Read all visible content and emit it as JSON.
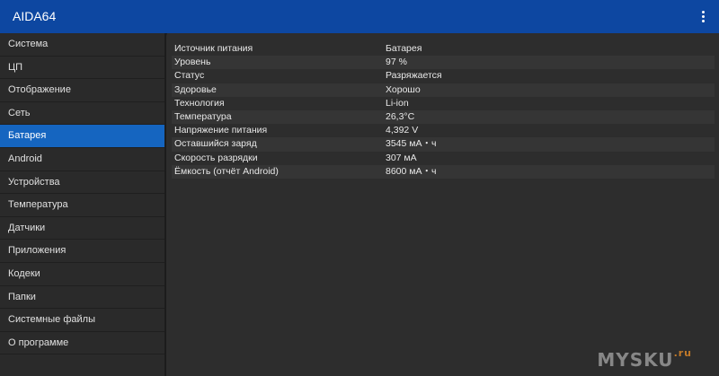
{
  "app": {
    "title": "AIDA64"
  },
  "sidebar": {
    "items": [
      {
        "label": "Система"
      },
      {
        "label": "ЦП"
      },
      {
        "label": "Отображение"
      },
      {
        "label": "Сеть"
      },
      {
        "label": "Батарея",
        "active": true
      },
      {
        "label": "Android"
      },
      {
        "label": "Устройства"
      },
      {
        "label": "Температура"
      },
      {
        "label": "Датчики"
      },
      {
        "label": "Приложения"
      },
      {
        "label": "Кодеки"
      },
      {
        "label": "Папки"
      },
      {
        "label": "Системные файлы"
      },
      {
        "label": "О программе"
      }
    ]
  },
  "battery": {
    "rows": [
      {
        "key": "Источник питания",
        "value": "Батарея"
      },
      {
        "key": "Уровень",
        "value": "97 %"
      },
      {
        "key": "Статус",
        "value": "Разряжается"
      },
      {
        "key": "Здоровье",
        "value": "Хорошо"
      },
      {
        "key": "Технология",
        "value": "Li-ion"
      },
      {
        "key": "Температура",
        "value": "26,3°C"
      },
      {
        "key": "Напряжение питания",
        "value": "4,392 V"
      },
      {
        "key": "Оставшийся заряд",
        "value": "3545 мА・ч"
      },
      {
        "key": "Скорость разрядки",
        "value": "307 мА"
      },
      {
        "key": "Ёмкость (отчёт Android)",
        "value": "8600 мА・ч"
      }
    ]
  },
  "watermark": {
    "text": "MYSKU",
    "suffix": ".ru"
  },
  "colors": {
    "appbar": "#0d47a1",
    "active_item": "#1565c0",
    "background": "#2d2d2d"
  }
}
